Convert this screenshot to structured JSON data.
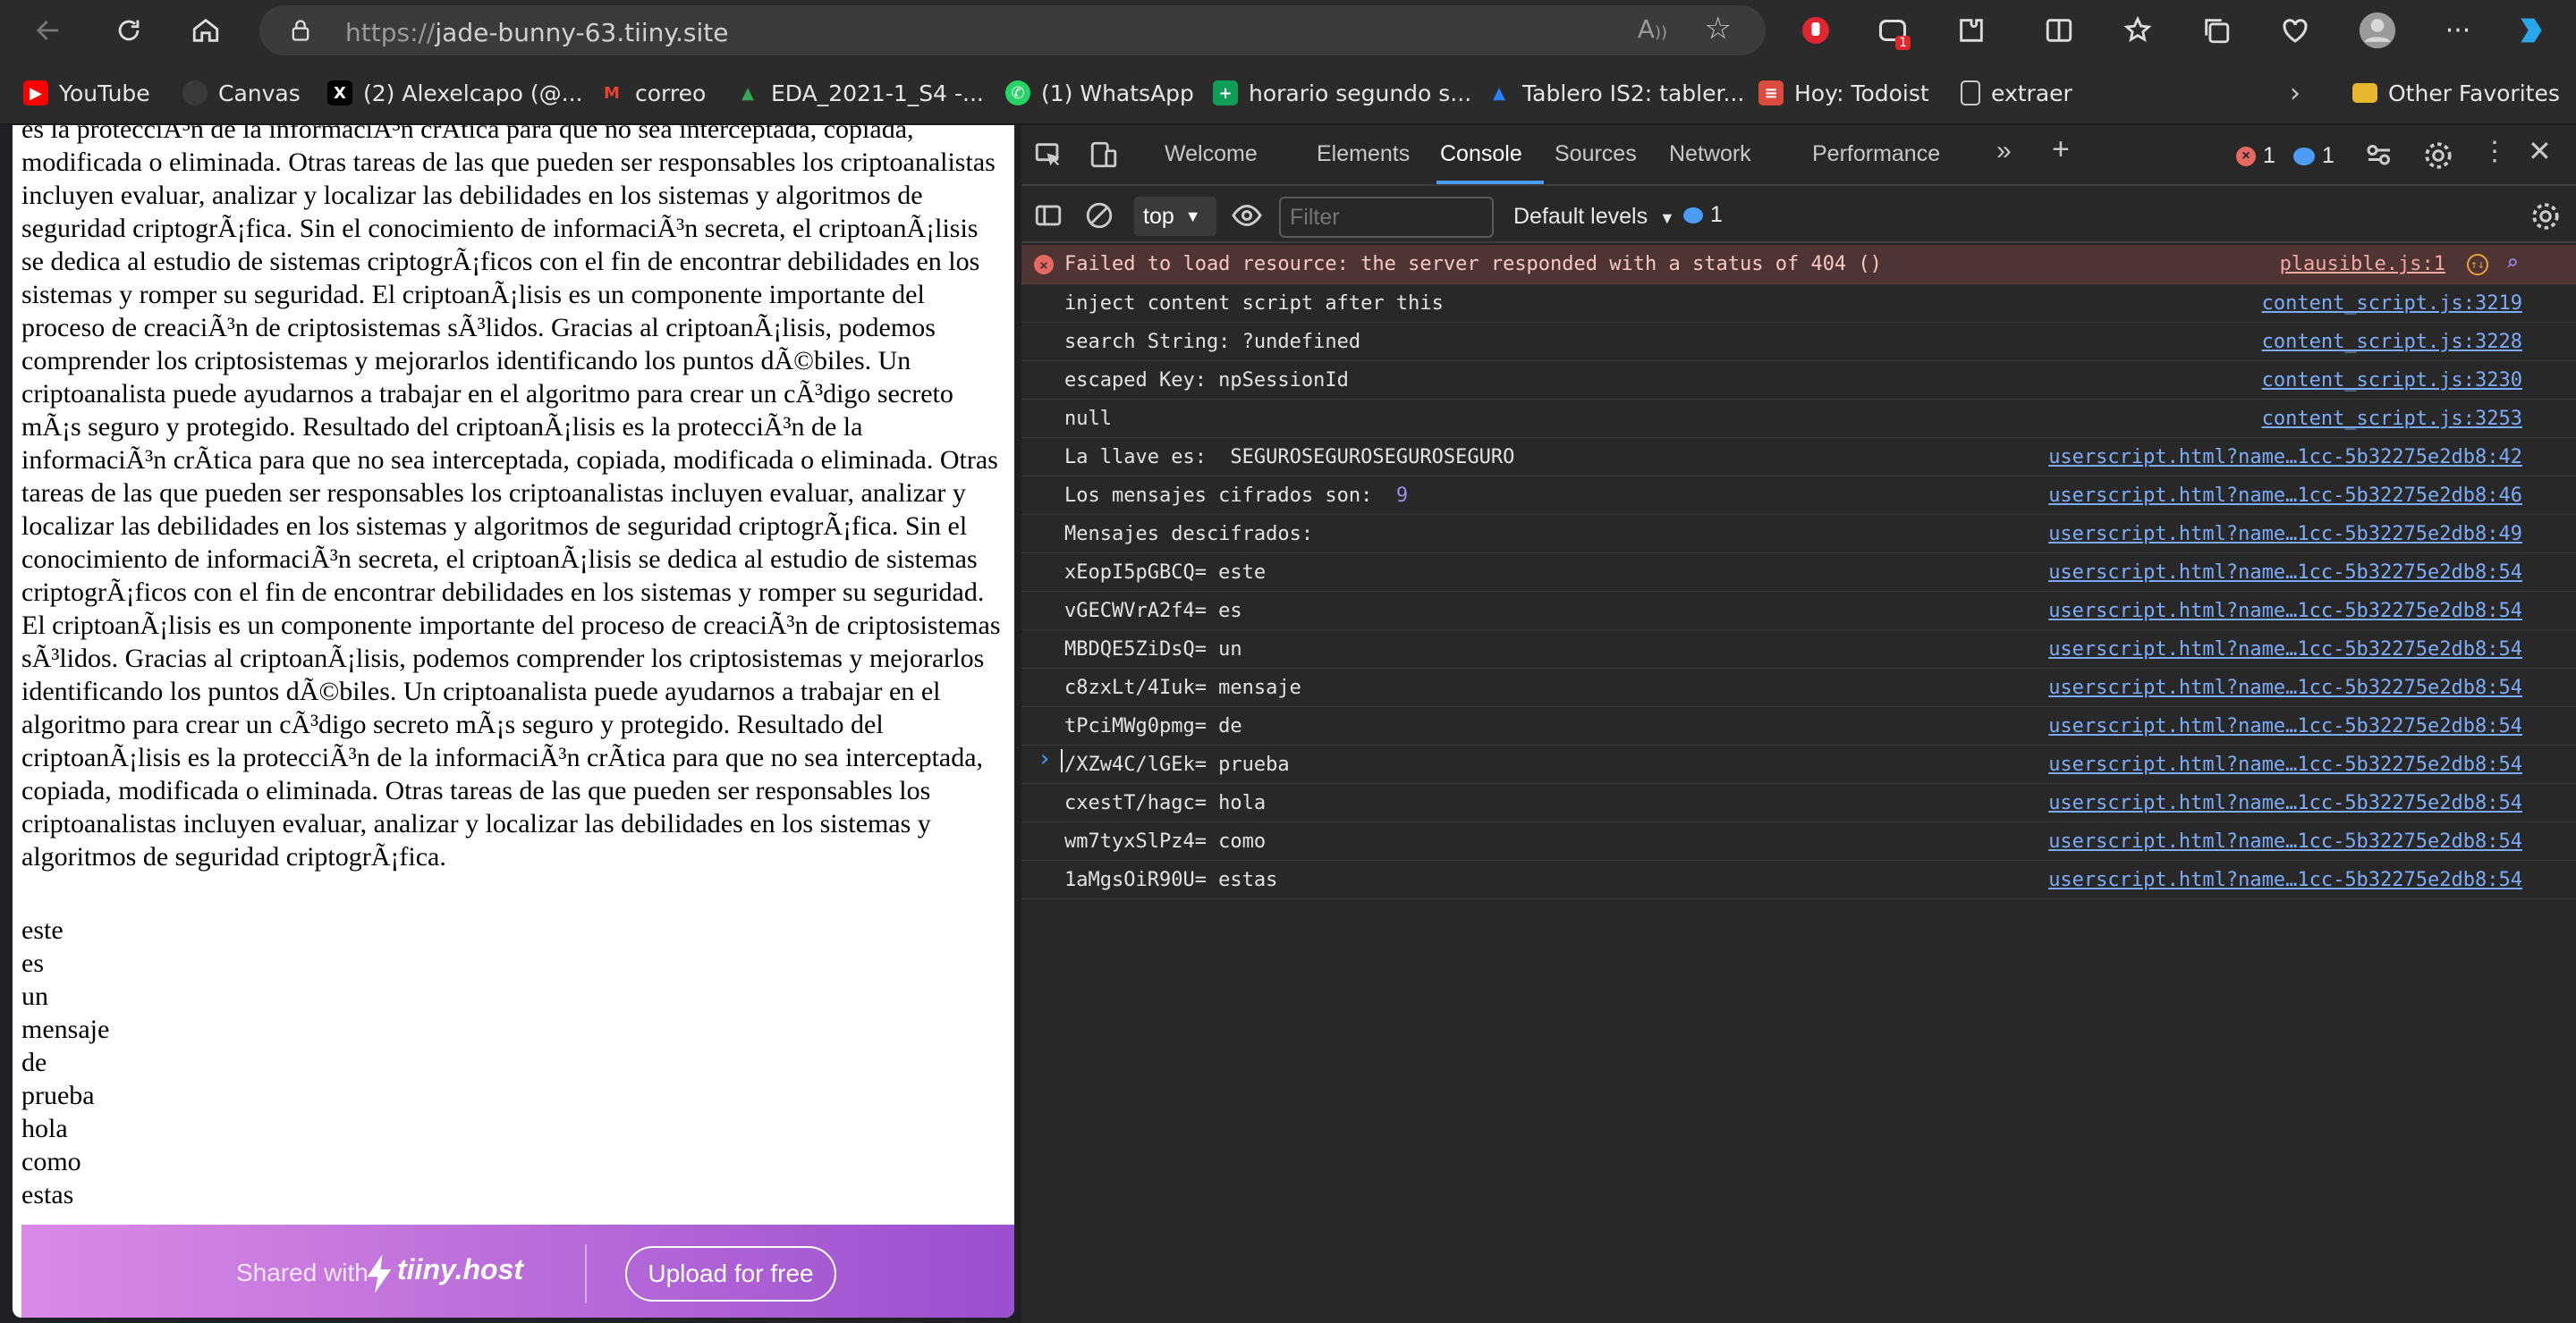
{
  "browser": {
    "url_scheme": "https://",
    "url_host": "jade-bunny-63.tiiny.site",
    "bookmarks": [
      {
        "label": "YouTube",
        "icon": "youtube-icon",
        "color": "#ff0000"
      },
      {
        "label": "Canvas",
        "icon": "canvas-icon",
        "color": "#3a3a3a"
      },
      {
        "label": "(2) Alexelcapo (@...",
        "icon": "x-icon",
        "color": "#000000"
      },
      {
        "label": "correo",
        "icon": "gmail-icon",
        "color": "#ea4335"
      },
      {
        "label": "EDA_2021-1_S4 -...",
        "icon": "drive-icon",
        "color": "#34a853"
      },
      {
        "label": "(1) WhatsApp",
        "icon": "whatsapp-icon",
        "color": "#25d366"
      },
      {
        "label": "horario segundo s...",
        "icon": "sheets-icon",
        "color": "#0f9d58"
      },
      {
        "label": "Tablero IS2: tabler...",
        "icon": "jira-icon",
        "color": "#2684ff"
      },
      {
        "label": "Hoy: Todoist",
        "icon": "todoist-icon",
        "color": "#db4c3f"
      },
      {
        "label": "extraer",
        "icon": "document-icon",
        "color": "#cccccc"
      }
    ],
    "other_favorites": "Other Favorites",
    "extension_badge": "1"
  },
  "page": {
    "paragraph": "es la protecciÃ³n de la informaciÃ³n crÃtica para que no sea interceptada, copiada, modificada o eliminada. Otras tareas de las que pueden ser responsables los criptoanalistas incluyen evaluar, analizar y localizar las debilidades en los sistemas y algoritmos de seguridad criptogrÃ¡fica. Sin el conocimiento de informaciÃ³n secreta, el criptoanÃ¡lisis se dedica al estudio de sistemas criptogrÃ¡ficos con el fin de encontrar debilidades en los sistemas y romper su seguridad. El criptoanÃ¡lisis es un componente importante del proceso de creaciÃ³n de criptosistemas sÃ³lidos. Gracias al criptoanÃ¡lisis, podemos comprender los criptosistemas y mejorarlos identificando los puntos dÃ©biles. Un criptoanalista puede ayudarnos a trabajar en el algoritmo para crear un cÃ³digo secreto mÃ¡s seguro y protegido. Resultado del criptoanÃ¡lisis es la protecciÃ³n de la informaciÃ³n crÃtica para que no sea interceptada, copiada, modificada o eliminada. Otras tareas de las que pueden ser responsables los criptoanalistas incluyen evaluar, analizar y localizar las debilidades en los sistemas y algoritmos de seguridad criptogrÃ¡fica. Sin el conocimiento de informaciÃ³n secreta, el criptoanÃ¡lisis se dedica al estudio de sistemas criptogrÃ¡ficos con el fin de encontrar debilidades en los sistemas y romper su seguridad. El criptoanÃ¡lisis es un componente importante del proceso de creaciÃ³n de criptosistemas sÃ³lidos. Gracias al criptoanÃ¡lisis, podemos comprender los criptosistemas y mejorarlos identificando los puntos dÃ©biles. Un criptoanalista puede ayudarnos a trabajar en el algoritmo para crear un cÃ³digo secreto mÃ¡s seguro y protegido. Resultado del criptoanÃ¡lisis es la protecciÃ³n de la informaciÃ³n crÃtica para que no sea interceptada, copiada, modificada o eliminada. Otras tareas de las que pueden ser responsables los criptoanalistas incluyen evaluar, analizar y localizar las debilidades en los sistemas y algoritmos de seguridad criptogrÃ¡fica.",
    "words": [
      "este",
      "es",
      "un",
      "mensaje",
      "de",
      "prueba",
      "hola",
      "como",
      "estas"
    ],
    "banner": {
      "shared_with": "Shared with",
      "brand": "tiiny.host",
      "upload_label": "Upload for free"
    }
  },
  "devtools": {
    "tabs": [
      "Welcome",
      "Elements",
      "Console",
      "Sources",
      "Network",
      "Performance"
    ],
    "active_tab": "Console",
    "error_count": "1",
    "info_count": "1",
    "context": "top",
    "filter_placeholder": "Filter",
    "levels_label": "Default levels",
    "issues_count": "1",
    "console": [
      {
        "type": "error",
        "text": "Failed to load resource: the server responded with a status of 404 ()",
        "source": "plausible.js:1"
      },
      {
        "type": "log",
        "text": "inject content script after this",
        "source": "content_script.js:3219"
      },
      {
        "type": "log",
        "text": "search String: ?undefined",
        "source": "content_script.js:3228"
      },
      {
        "type": "log",
        "text": "escaped Key: npSessionId",
        "source": "content_script.js:3230"
      },
      {
        "type": "null",
        "text": "null",
        "source": "content_script.js:3253"
      },
      {
        "type": "log",
        "text": "La llave es:  SEGUROSEGUROSEGUROSEGURO",
        "source": "userscript.html?name…1cc-5b32275e2db8:42"
      },
      {
        "type": "num",
        "text": "Los mensajes cifrados son:  ",
        "value": "9",
        "source": "userscript.html?name…1cc-5b32275e2db8:46"
      },
      {
        "type": "log",
        "text": "Mensajes descifrados:",
        "source": "userscript.html?name…1cc-5b32275e2db8:49"
      },
      {
        "type": "log",
        "text": "xEopI5pGBCQ= este",
        "source": "userscript.html?name…1cc-5b32275e2db8:54"
      },
      {
        "type": "log",
        "text": "vGECWVrA2f4= es",
        "source": "userscript.html?name…1cc-5b32275e2db8:54"
      },
      {
        "type": "log",
        "text": "MBDQE5ZiDsQ= un",
        "source": "userscript.html?name…1cc-5b32275e2db8:54"
      },
      {
        "type": "log",
        "text": "c8zxLt/4Iuk= mensaje",
        "source": "userscript.html?name…1cc-5b32275e2db8:54"
      },
      {
        "type": "log",
        "text": "tPciMWg0pmg= de",
        "source": "userscript.html?name…1cc-5b32275e2db8:54"
      },
      {
        "type": "log",
        "text": "/XZw4C/lGEk= prueba",
        "source": "userscript.html?name…1cc-5b32275e2db8:54"
      },
      {
        "type": "log",
        "text": "cxestT/hagc= hola",
        "source": "userscript.html?name…1cc-5b32275e2db8:54"
      },
      {
        "type": "log",
        "text": "wm7tyxSlPz4= como",
        "source": "userscript.html?name…1cc-5b32275e2db8:54"
      },
      {
        "type": "log",
        "text": "1aMgsOiR90U= estas",
        "source": "userscript.html?name…1cc-5b32275e2db8:54"
      }
    ]
  }
}
